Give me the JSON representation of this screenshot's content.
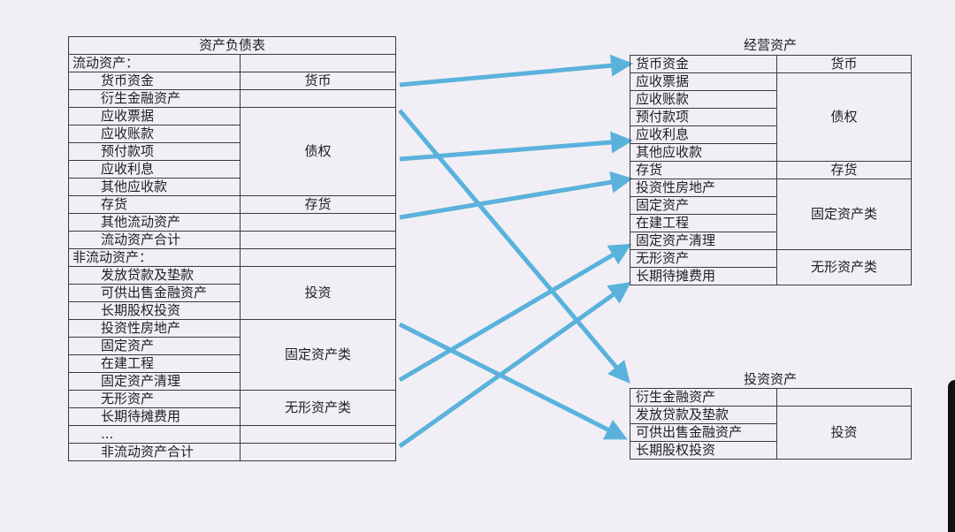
{
  "left_table": {
    "title": "资产负债表",
    "rows": [
      {
        "item": "流动资产：",
        "category": ""
      },
      {
        "item": "货币资金",
        "category": "货币"
      },
      {
        "item": "衍生金融资产",
        "category": ""
      },
      {
        "item": "应收票据",
        "category": "债权"
      },
      {
        "item": "应收账款",
        "category": "债权"
      },
      {
        "item": "预付款项",
        "category": "债权"
      },
      {
        "item": "应收利息",
        "category": "债权"
      },
      {
        "item": "其他应收款",
        "category": "债权"
      },
      {
        "item": "存货",
        "category": "存货"
      },
      {
        "item": "其他流动资产",
        "category": ""
      },
      {
        "item": "流动资产合计",
        "category": ""
      },
      {
        "item": "非流动资产：",
        "category": ""
      },
      {
        "item": "发放贷款及垫款",
        "category": "投资"
      },
      {
        "item": "可供出售金融资产",
        "category": "投资"
      },
      {
        "item": "长期股权投资",
        "category": "投资"
      },
      {
        "item": "投资性房地产",
        "category": "固定资产类"
      },
      {
        "item": "固定资产",
        "category": "固定资产类"
      },
      {
        "item": "在建工程",
        "category": "固定资产类"
      },
      {
        "item": "固定资产清理",
        "category": "固定资产类"
      },
      {
        "item": "无形资产",
        "category": "无形资产类"
      },
      {
        "item": "长期待摊费用",
        "category": "无形资产类"
      },
      {
        "item": "...",
        "category": ""
      },
      {
        "item": "非流动资产合计",
        "category": ""
      }
    ]
  },
  "operating_table": {
    "title": "经营资产",
    "rows": [
      {
        "item": "货币资金",
        "category": "货币"
      },
      {
        "item": "应收票据",
        "category": "债权"
      },
      {
        "item": "应收账款",
        "category": "债权"
      },
      {
        "item": "预付款项",
        "category": "债权"
      },
      {
        "item": "应收利息",
        "category": "债权"
      },
      {
        "item": "其他应收款",
        "category": "债权"
      },
      {
        "item": "存货",
        "category": "存货"
      },
      {
        "item": "投资性房地产",
        "category": "固定资产类"
      },
      {
        "item": "固定资产",
        "category": "固定资产类"
      },
      {
        "item": "在建工程",
        "category": "固定资产类"
      },
      {
        "item": "固定资产清理",
        "category": "固定资产类"
      },
      {
        "item": "无形资产",
        "category": "无形资产类"
      },
      {
        "item": "长期待摊费用",
        "category": "无形资产类"
      }
    ]
  },
  "investment_table": {
    "title": "投资资产",
    "rows": [
      {
        "item": "衍生金融资产",
        "category": ""
      },
      {
        "item": "发放贷款及垫款",
        "category": "投资"
      },
      {
        "item": "可供出售金融资产",
        "category": "投资"
      },
      {
        "item": "长期股权投资",
        "category": "投资"
      }
    ]
  },
  "colors": {
    "arrow": "#5ab2dc",
    "border": "#3a3a3a",
    "background": "#f1eff5"
  }
}
